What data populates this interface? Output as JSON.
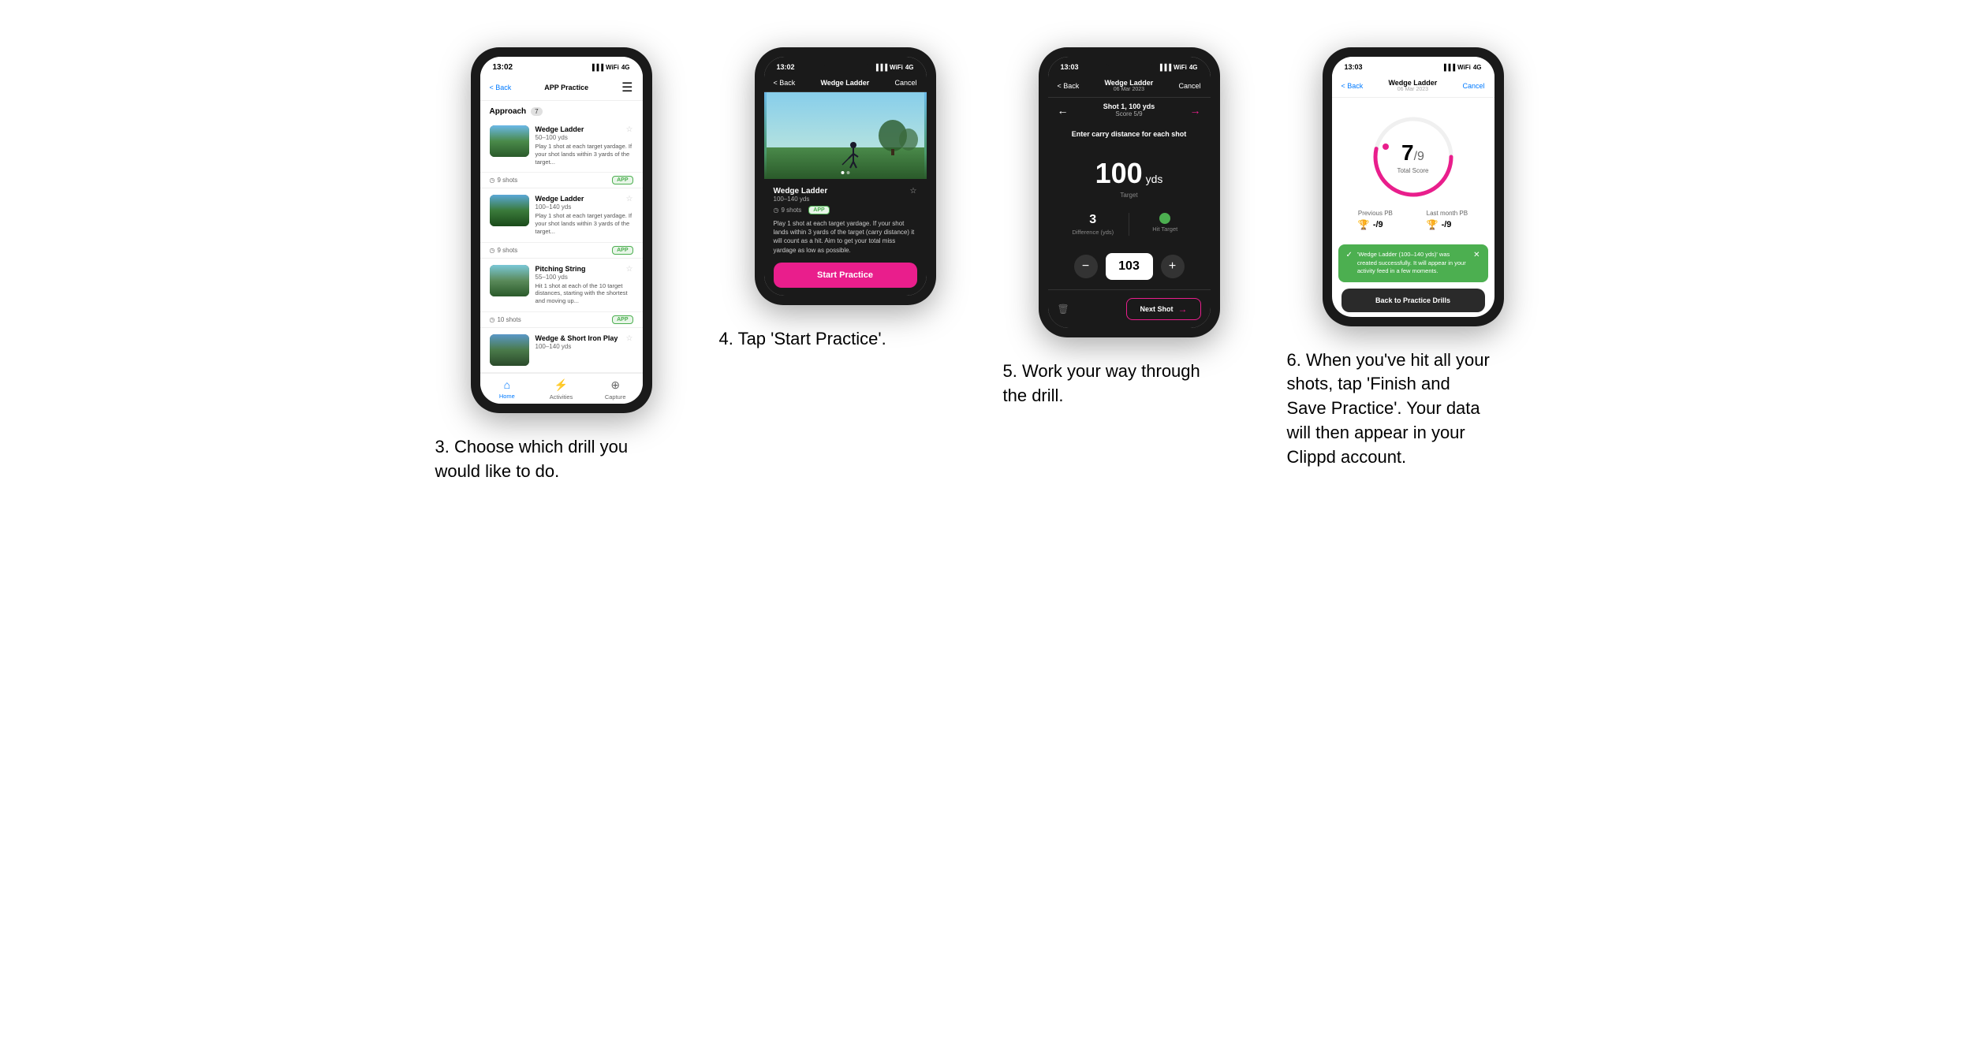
{
  "screens": [
    {
      "id": "screen1",
      "time": "13:02",
      "nav_back": "< Back",
      "nav_title": "APP Practice",
      "section": "Approach",
      "badge": "7",
      "drills": [
        {
          "name": "Wedge Ladder",
          "range": "50–100 yds",
          "desc": "Play 1 shot at each target yardage. If your shot lands within 3 yards of the target...",
          "shots": "9 shots",
          "badge": "APP",
          "color1": "#4a7a4a",
          "color2": "#2a5a2a"
        },
        {
          "name": "Wedge Ladder",
          "range": "100–140 yds",
          "desc": "Play 1 shot at each target yardage. If your shot lands within 3 yards of the target...",
          "shots": "9 shots",
          "badge": "APP",
          "color1": "#3a6a3a",
          "color2": "#1a4a1a"
        },
        {
          "name": "Pitching String",
          "range": "55–100 yds",
          "desc": "Hit 1 shot at each of the 10 target distances, starting with the shortest and moving up...",
          "shots": "10 shots",
          "badge": "APP",
          "color1": "#5a7a5a",
          "color2": "#2a4a2a"
        },
        {
          "name": "Wedge & Short Iron Play",
          "range": "100–140 yds",
          "desc": "",
          "shots": "",
          "badge": "",
          "color1": "#4a6a4a",
          "color2": "#2a4a2a"
        }
      ],
      "tabs": [
        {
          "label": "Home",
          "icon": "⌂",
          "active": true
        },
        {
          "label": "Activities",
          "icon": "⚡",
          "active": false
        },
        {
          "label": "Capture",
          "icon": "⊕",
          "active": false
        }
      ]
    },
    {
      "id": "screen2",
      "time": "13:02",
      "nav_back": "< Back",
      "nav_title": "Wedge Ladder",
      "nav_cancel": "Cancel",
      "drill_name": "Wedge Ladder",
      "drill_range": "100–140 yds",
      "drill_shots": "9 shots",
      "drill_badge": "APP",
      "drill_desc": "Play 1 shot at each target yardage. If your shot lands within 3 yards of the target (carry distance) it will count as a hit. Aim to get your total miss yardage as low as possible.",
      "start_label": "Start Practice"
    },
    {
      "id": "screen3",
      "time": "13:03",
      "nav_title_main": "Wedge Ladder",
      "nav_title_sub": "06 Mar 2023",
      "nav_cancel": "Cancel",
      "nav_back": "< Back",
      "shot_label": "Shot 1, 100 yds",
      "shot_score": "Score 5/9",
      "carry_prompt_prefix": "Enter ",
      "carry_prompt_bold": "carry distance",
      "carry_prompt_suffix": " for each shot",
      "target_num": "100",
      "target_unit": "yds",
      "target_label": "Target",
      "stat_difference": "3",
      "stat_difference_label": "Difference (yds)",
      "stat_hit": "Hit Target",
      "input_value": "103",
      "next_shot_label": "Next Shot",
      "delete_icon": "🗑"
    },
    {
      "id": "screen4",
      "time": "13:03",
      "nav_title_main": "Wedge Ladder",
      "nav_title_sub": "06 Mar 2023",
      "nav_cancel": "Cancel",
      "nav_back": "< Back",
      "score_num": "7",
      "score_denom": "/9",
      "score_label": "Total Score",
      "prev_pb_label": "Previous PB",
      "prev_pb_val": "-/9",
      "last_pb_label": "Last month PB",
      "last_pb_val": "-/9",
      "toast_text": "'Wedge Ladder (100–140 yds)' was created successfully. It will appear in your activity feed in a few moments.",
      "back_btn_label": "Back to Practice Drills",
      "dot_color": "#E91E8C"
    }
  ],
  "captions": [
    "3. Choose which drill you would like to do.",
    "4. Tap 'Start Practice'.",
    "5. Work your way through the drill.",
    "6. When you've hit all your shots, tap 'Finish and Save Practice'. Your data will then appear in your Clippd account."
  ]
}
